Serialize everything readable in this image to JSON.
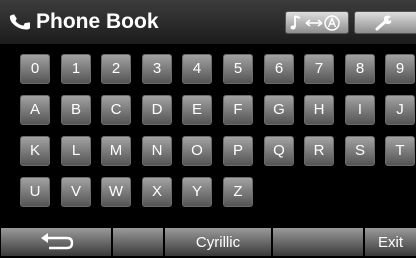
{
  "header": {
    "title": "Phone Book",
    "title_icon": "phone-handset-icon",
    "source_button_icon": "music-to-audio-icon",
    "settings_button_icon": "wrench-icon"
  },
  "keyboard": {
    "rows": [
      [
        "0",
        "1",
        "2",
        "3",
        "4",
        "5",
        "6",
        "7",
        "8",
        "9"
      ],
      [
        "A",
        "B",
        "C",
        "D",
        "E",
        "F",
        "G",
        "H",
        "I",
        "J"
      ],
      [
        "K",
        "L",
        "M",
        "N",
        "O",
        "P",
        "Q",
        "R",
        "S",
        "T"
      ],
      [
        "U",
        "V",
        "W",
        "X",
        "Y",
        "Z"
      ]
    ]
  },
  "bottom_bar": {
    "back_icon": "return-arrow-icon",
    "cyrillic_label": "Cyrillic",
    "exit_label": "Exit"
  }
}
